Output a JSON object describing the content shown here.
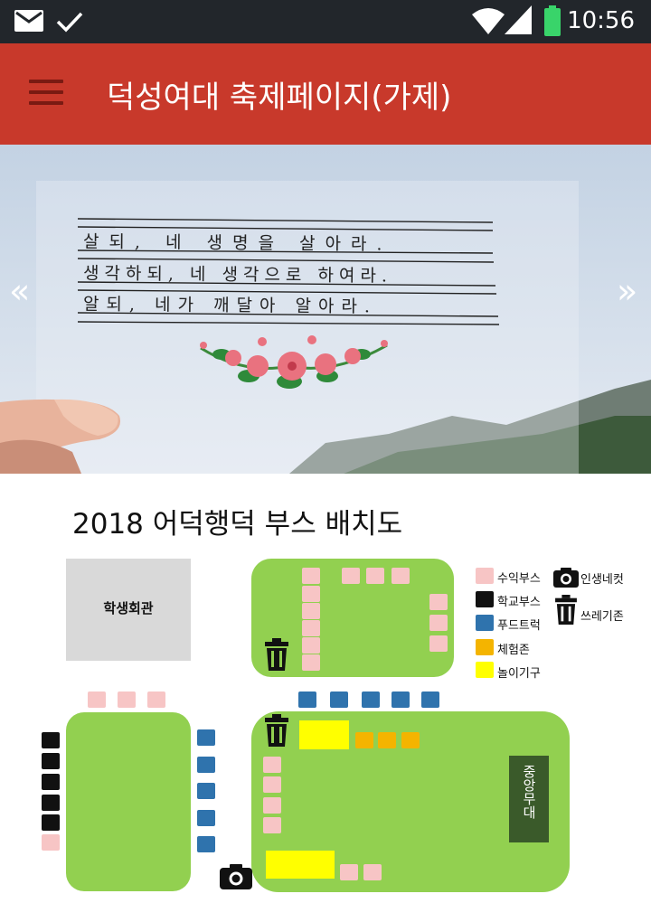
{
  "status_bar": {
    "time": "10:56",
    "icons": [
      "mail-icon",
      "check-icon",
      "wifi-icon",
      "cell-signal-icon",
      "battery-icon"
    ]
  },
  "app_bar": {
    "title": "덕성여대 축제페이지(가제)",
    "menu_icon": "hamburger-menu-icon"
  },
  "banner": {
    "prev_arrow": "«",
    "next_arrow": "»",
    "lines": [
      "살되, 네 생명을 살아라.",
      "생각하되, 네 생각으로 하여라.",
      "알되, 네가 깨달아 알아라."
    ]
  },
  "booth_map": {
    "title": "2018 어덕행덕 부스 배치도",
    "student_hall_label": "학생회관",
    "central_stage_label": "중앙무대",
    "legend": [
      {
        "label": "수익부스",
        "color": "#f7c5c5"
      },
      {
        "label": "학교부스",
        "color": "#111111"
      },
      {
        "label": "푸드트럭",
        "color": "#2f73ad"
      },
      {
        "label": "체험존",
        "color": "#f4b400"
      },
      {
        "label": "놀이기구",
        "color": "#ffff00"
      }
    ],
    "legend_icons": [
      {
        "label": "인생네컷",
        "icon": "camera-icon"
      },
      {
        "label": "쓰레기존",
        "icon": "trash-can-icon"
      }
    ]
  },
  "colors": {
    "status_bar": "#22262b",
    "app_bar": "#c8392b",
    "zone_green": "#92d050"
  }
}
